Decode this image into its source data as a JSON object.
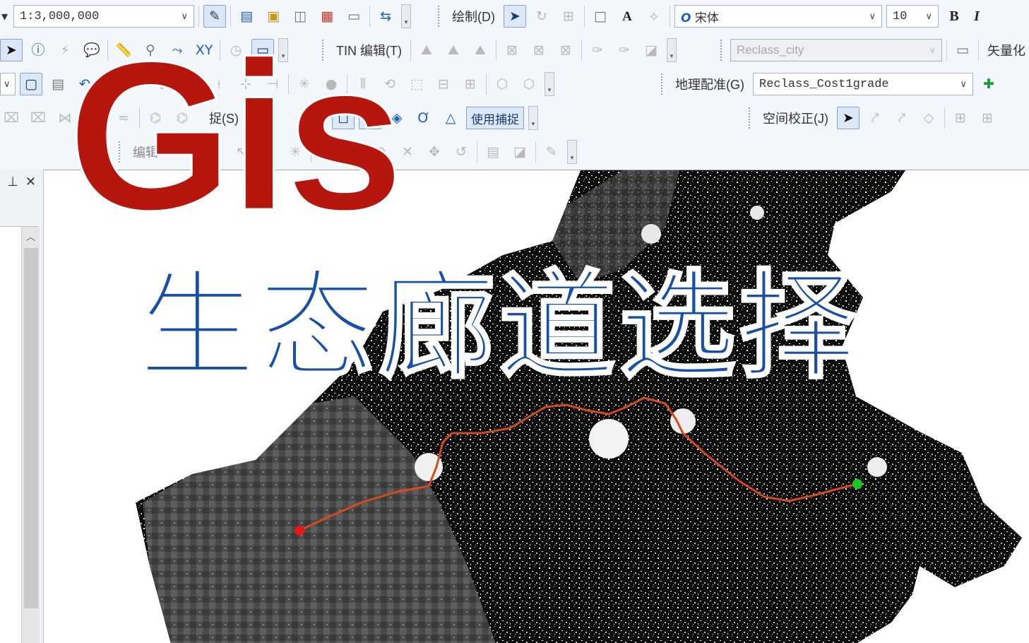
{
  "overlay": {
    "title": "Gis",
    "subtitle": "生态廊道选择",
    "title_color": "#b5160e",
    "subtitle_color": "#1850a8"
  },
  "toolbar": {
    "scale_value": "1:3,000,000",
    "draw_menu": "绘制(D)",
    "font_name": "宋体",
    "font_size": "10",
    "bold_label": "B",
    "italic_label": "I",
    "tin_edit_menu": "TIN 编辑(T)",
    "raster_layer": "Reclass_city",
    "vectorize_label": "矢量化",
    "georef_menu": "地理配准(G)",
    "georef_layer": "Reclass_Cost1grade",
    "snapping_menu": "捉(S)",
    "use_snapping": "使用捕捉",
    "spatial_adjust_menu": "空间校正(J)",
    "editor_menu": "编辑"
  },
  "panel": {
    "pin_icon": "pin-icon",
    "close_icon": "close-icon"
  },
  "map": {
    "path_color": "#d24a1e",
    "source_color": "#e8161a",
    "destination_color": "#19c81e",
    "terrain_dark": "#0d0d0d",
    "terrain_mid": "#5a5a5a"
  }
}
